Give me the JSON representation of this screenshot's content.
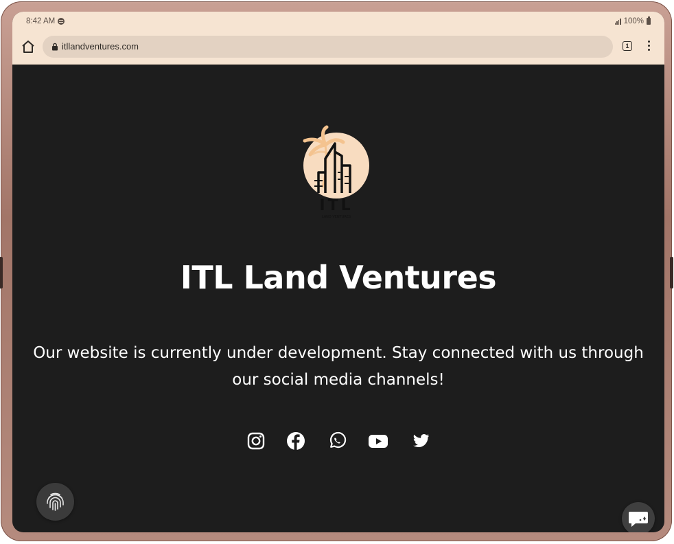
{
  "status_bar": {
    "time": "8:42 AM",
    "notification_icon": "spotify-icon",
    "battery": "100%"
  },
  "browser": {
    "url": "itllandventures.com",
    "tab_count": "1"
  },
  "page": {
    "logo": {
      "letters": "ITL",
      "tagline": "LAND VENTURES"
    },
    "title": "ITL Land Ventures",
    "description": "Our website is currently under development. Stay connected with us through our social media channels!",
    "social_links": [
      "instagram-icon",
      "facebook-icon",
      "whatsapp-icon",
      "youtube-icon",
      "twitter-icon"
    ]
  },
  "colors": {
    "background": "#1d1d1d",
    "browser_chrome": "#f6e4d2",
    "logo_circle": "#f8dcc0",
    "text": "#ffffff"
  }
}
